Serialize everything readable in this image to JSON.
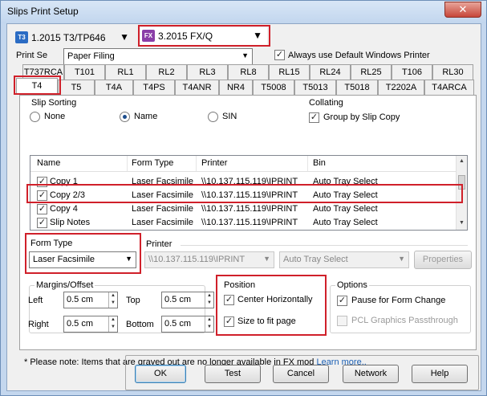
{
  "window": {
    "title": "Slips Print Setup",
    "close_label": "✕"
  },
  "top": {
    "profile_combo": {
      "icon_text": "T3",
      "icon_color": "#2b6cc4",
      "value": "1.2015 T3/TP646"
    },
    "form_combo": {
      "icon_text": "FX",
      "icon_color": "#8a3fa8",
      "value": "3.2015 FX/Q"
    },
    "print_set_label": "Print Se",
    "print_set_value": "Paper Filing",
    "always_default_label": "Always use Default Windows Printer"
  },
  "tabs_row1": [
    "T737RCA",
    "T101",
    "RL1",
    "RL2",
    "RL3",
    "RL8",
    "RL15",
    "RL24",
    "RL25",
    "T106",
    "RL30"
  ],
  "tabs_row2": [
    "T4",
    "T5",
    "T4A",
    "T4PS",
    "T4ANR",
    "NR4",
    "T5008",
    "T5013",
    "T5018",
    "T2202A",
    "T4ARCA"
  ],
  "slip_sorting": {
    "title": "Slip Sorting",
    "options": [
      "None",
      "Name",
      "SIN"
    ]
  },
  "collating": {
    "title": "Collating",
    "group_label": "Group by Slip Copy"
  },
  "list": {
    "headers": [
      "Name",
      "Form Type",
      "Printer",
      "Bin"
    ],
    "rows": [
      {
        "name": "Copy 1",
        "form": "Laser Facsimile",
        "printer": "\\\\10.137.115.119\\IPRINT",
        "bin": "Auto Tray Select"
      },
      {
        "name": "Copy 2/3",
        "form": "Laser Facsimile",
        "printer": "\\\\10.137.115.119\\IPRINT",
        "bin": "Auto Tray Select"
      },
      {
        "name": "Copy 4",
        "form": "Laser Facsimile",
        "printer": "\\\\10.137.115.119\\IPRINT",
        "bin": "Auto Tray Select"
      },
      {
        "name": "Slip Notes",
        "form": "Laser Facsimile",
        "printer": "\\\\10.137.115.119\\IPRINT",
        "bin": "Auto Tray Select"
      }
    ]
  },
  "form_type": {
    "label": "Form Type",
    "value": "Laser Facsimile"
  },
  "printer": {
    "label": "Printer",
    "value": "\\\\10.137.115.119\\IPRINT",
    "bin_value": "Auto Tray Select",
    "properties_label": "Properties"
  },
  "margins": {
    "title": "Margins/Offset",
    "left_label": "Left",
    "left_value": "0.5 cm",
    "top_label": "Top",
    "top_value": "0.5 cm",
    "right_label": "Right",
    "right_value": "0.5 cm",
    "bottom_label": "Bottom",
    "bottom_value": "0.5 cm"
  },
  "position": {
    "title": "Position",
    "center_label": "Center Horizontally",
    "fit_label": "Size to fit page"
  },
  "options": {
    "title": "Options",
    "pause_label": "Pause for Form Change",
    "pcl_label": "PCL Graphics Passthrough"
  },
  "note": {
    "text": "* Please note: Items that are grayed out are no longer available in FX mod",
    "link": "Learn more.."
  },
  "buttons": {
    "ok": "OK",
    "test": "Test",
    "cancel": "Cancel",
    "network": "Network",
    "help": "Help"
  },
  "colors": {
    "highlight": "#d0202a",
    "accent": "#1c4d8c"
  }
}
